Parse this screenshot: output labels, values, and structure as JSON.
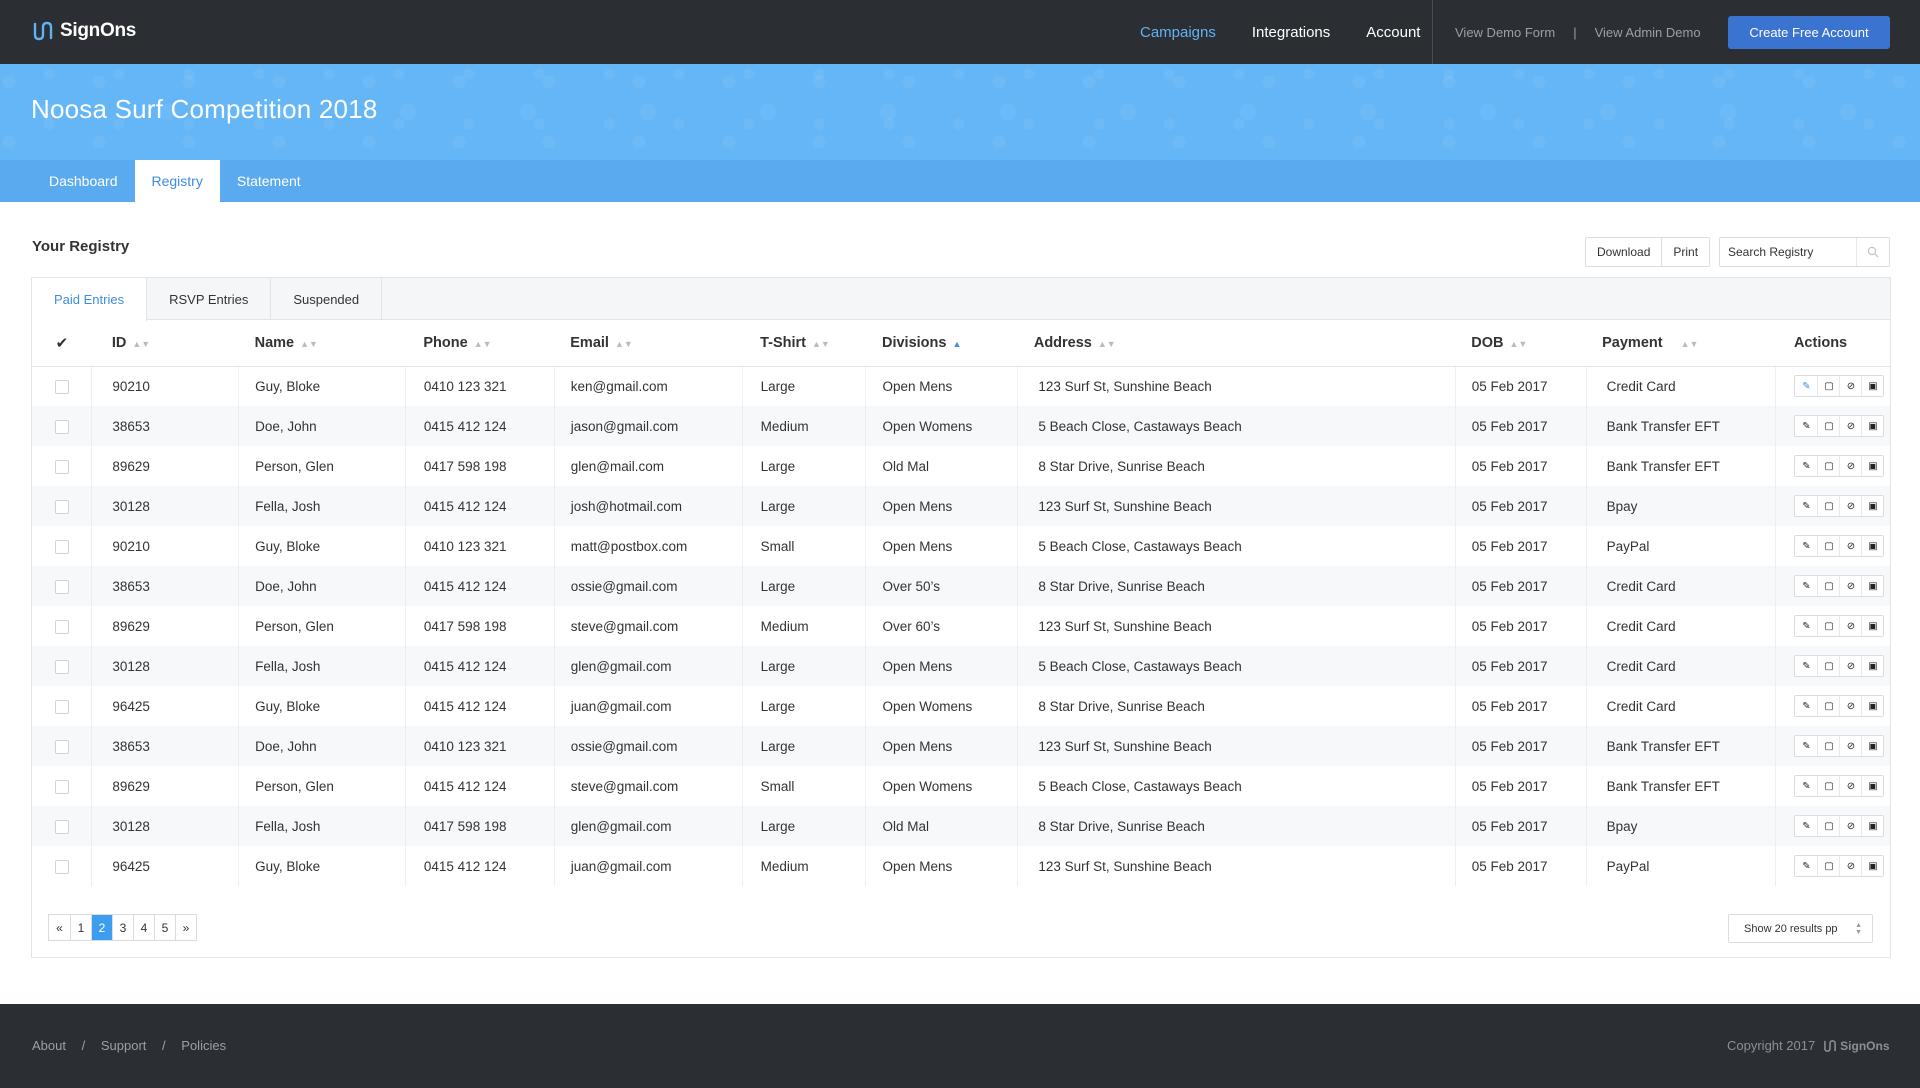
{
  "brand": {
    "name": "SignOns",
    "logo_icon": "signons-logo-icon"
  },
  "nav": {
    "main": [
      {
        "label": "Campaigns",
        "active": true
      },
      {
        "label": "Integrations",
        "active": false
      },
      {
        "label": "Account",
        "active": false
      }
    ],
    "demo": [
      "View Demo Form",
      "View Admin Demo"
    ],
    "demo_separator": "|",
    "cta": "Create Free Account"
  },
  "banner": {
    "title": "Noosa Surf Competition 2018",
    "tabs": [
      {
        "label": "Dashboard",
        "active": false
      },
      {
        "label": "Registry",
        "active": true
      },
      {
        "label": "Statement",
        "active": false
      }
    ]
  },
  "registry": {
    "title": "Your Registry",
    "download_label": "Download",
    "print_label": "Print",
    "search_placeholder": "Search Registry",
    "subtabs": [
      {
        "label": "Paid Entries",
        "active": true
      },
      {
        "label": "RSVP Entries",
        "active": false
      },
      {
        "label": "Suspended",
        "active": false
      }
    ],
    "columns": [
      "ID",
      "Name",
      "Phone",
      "Email",
      "T-Shirt",
      "Divisions",
      "Address",
      "DOB",
      "Payment",
      "Actions"
    ],
    "sorted_column": "Divisions",
    "rows": [
      [
        "90210",
        "Guy, Bloke",
        "0410 123 321",
        "ken@gmail.com",
        "Large",
        "Open Mens",
        "123 Surf St, Sunshine Beach",
        "05 Feb 2017",
        "Credit Card"
      ],
      [
        "38653",
        "Doe, John",
        "0415 412 124",
        "jason@gmail.com",
        "Medium",
        "Open Womens",
        "5 Beach Close, Castaways Beach",
        "05 Feb 2017",
        "Bank Transfer EFT"
      ],
      [
        "89629",
        "Person, Glen",
        "0417 598 198",
        "glen@mail.com",
        "Large",
        "Old Mal",
        "8 Star Drive, Sunrise Beach",
        "05 Feb 2017",
        "Bank Transfer EFT"
      ],
      [
        "30128",
        "Fella, Josh",
        "0415 412 124",
        "josh@hotmail.com",
        "Large",
        "Open Mens",
        "123 Surf St, Sunshine Beach",
        "05 Feb 2017",
        "Bpay"
      ],
      [
        "90210",
        "Guy, Bloke",
        "0410 123 321",
        "matt@postbox.com",
        "Small",
        "Open Mens",
        "5 Beach Close, Castaways Beach",
        "05 Feb 2017",
        "PayPal"
      ],
      [
        "38653",
        "Doe, John",
        "0415 412 124",
        "ossie@gmail.com",
        "Large",
        "Over 50’s",
        "8 Star Drive, Sunrise Beach",
        "05 Feb 2017",
        "Credit Card"
      ],
      [
        "89629",
        "Person, Glen",
        "0417 598 198",
        "steve@gmail.com",
        "Medium",
        "Over 60’s",
        "123 Surf St, Sunshine Beach",
        "05 Feb 2017",
        "Credit Card"
      ],
      [
        "30128",
        "Fella, Josh",
        "0415 412 124",
        "glen@gmail.com",
        "Large",
        "Open Mens",
        "5 Beach Close, Castaways Beach",
        "05 Feb 2017",
        "Credit Card"
      ],
      [
        "96425",
        "Guy, Bloke",
        "0415 412 124",
        "juan@gmail.com",
        "Large",
        "Open Womens",
        "8 Star Drive, Sunrise Beach",
        "05 Feb 2017",
        "Credit Card"
      ],
      [
        "38653",
        "Doe, John",
        "0410 123 321",
        "ossie@gmail.com",
        "Large",
        "Open Mens",
        "123 Surf St, Sunshine Beach",
        "05 Feb 2017",
        "Bank Transfer EFT"
      ],
      [
        "89629",
        "Person, Glen",
        "0415 412 124",
        "steve@gmail.com",
        "Small",
        "Open Womens",
        "5 Beach Close, Castaways Beach",
        "05 Feb 2017",
        "Bank Transfer EFT"
      ],
      [
        "30128",
        "Fella, Josh",
        "0417 598 198",
        "glen@gmail.com",
        "Large",
        "Old Mal",
        "8 Star Drive, Sunrise Beach",
        "05 Feb 2017",
        "Bpay"
      ],
      [
        "96425",
        "Guy, Bloke",
        "0415 412 124",
        "juan@gmail.com",
        "Medium",
        "Open Mens",
        "123 Surf St, Sunshine Beach",
        "05 Feb 2017",
        "PayPal"
      ]
    ],
    "row_actions": [
      "edit-icon",
      "note-icon",
      "suspend-icon",
      "payment-icon"
    ],
    "pagination": {
      "prev": "«",
      "pages": [
        "1",
        "2",
        "3",
        "4",
        "5"
      ],
      "current": "2",
      "next": "»"
    },
    "per_page": "Show 20 results pp"
  },
  "footer": {
    "links": [
      "About",
      "Support",
      "Policies"
    ],
    "separator": "/",
    "copyright": "Copyright 2017",
    "brand": "SignOns"
  },
  "colors": {
    "nav_bg": "#2b2e33",
    "banner": "#64b6f7",
    "accent": "#3d8ee0",
    "cta": "#3b73d1"
  }
}
